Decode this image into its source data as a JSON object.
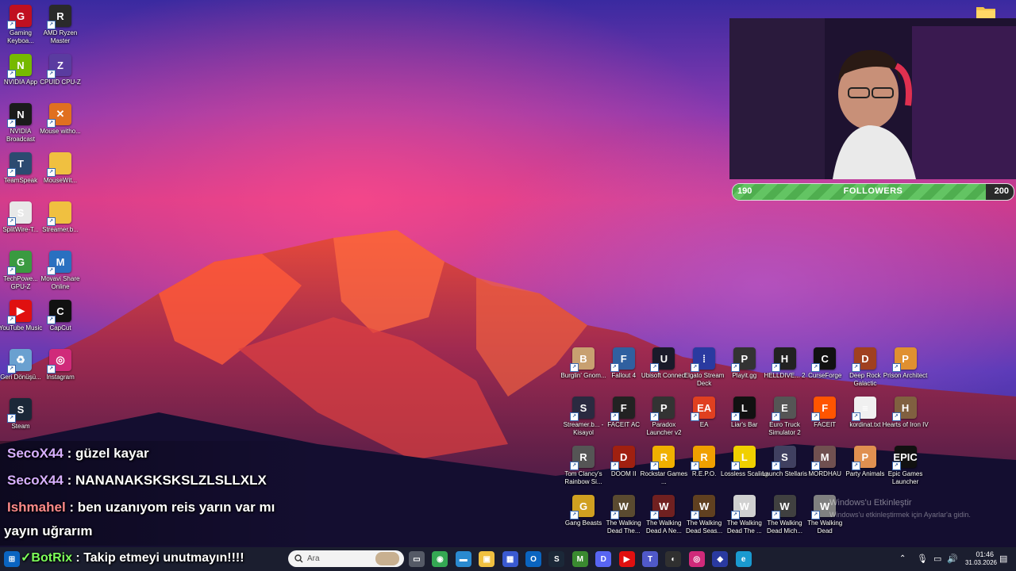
{
  "desktop_left": [
    {
      "name": "gaming-keyboard",
      "label": "Gaming Keyboa...",
      "color": "#c01020",
      "glyph": "G"
    },
    {
      "name": "amd-ryzen-master",
      "label": "AMD Ryzen Master",
      "color": "#2a2a2a",
      "glyph": "R"
    },
    {
      "name": "nvidia-app",
      "label": "NVIDIA App",
      "color": "#76b900",
      "glyph": "N"
    },
    {
      "name": "cpuid-cpu-z",
      "label": "CPUID CPU-Z",
      "color": "#5a3ca0",
      "glyph": "Z"
    },
    {
      "name": "nvidia-broadcast",
      "label": "NVIDIA Broadcast",
      "color": "#1b1b1b",
      "glyph": "N"
    },
    {
      "name": "mouse-without",
      "label": "Mouse witho...",
      "color": "#e07020",
      "glyph": "✕"
    },
    {
      "name": "teamspeak",
      "label": "TeamSpeak",
      "color": "#2c4a70",
      "glyph": "T"
    },
    {
      "name": "mousewit-folder",
      "label": "MouseWit...",
      "color": "#f0c040",
      "glyph": ""
    },
    {
      "name": "splitwire",
      "label": "SplitWire-T...",
      "color": "#e8e8e8",
      "glyph": "S"
    },
    {
      "name": "streamer-folder",
      "label": "Streamer.b...",
      "color": "#f0c040",
      "glyph": ""
    },
    {
      "name": "techpowerup-gpuz",
      "label": "TechPowe... GPU-Z",
      "color": "#3a9a40",
      "glyph": "G"
    },
    {
      "name": "movavi-share",
      "label": "Movavi Share Online",
      "color": "#2a70c0",
      "glyph": "M"
    },
    {
      "name": "youtube-music",
      "label": "YouTube Music",
      "color": "#e01010",
      "glyph": "▶"
    },
    {
      "name": "capcut",
      "label": "CapCut",
      "color": "#111111",
      "glyph": "C"
    },
    {
      "name": "recycle-bin",
      "label": "Geri Dönüşü...",
      "color": "#6aa0d0",
      "glyph": "♻"
    },
    {
      "name": "instagram",
      "label": "Instagram",
      "color": "#d02a7a",
      "glyph": "◎"
    },
    {
      "name": "steam",
      "label": "Steam",
      "color": "#1b2838",
      "glyph": "S"
    }
  ],
  "desktop_right": [
    {
      "name": "burglin-gnomes",
      "label": "Burglin' Gnom...",
      "color": "#c8a070",
      "glyph": "B"
    },
    {
      "name": "fallout-4",
      "label": "Fallout 4",
      "color": "#3060a0",
      "glyph": "F"
    },
    {
      "name": "ubisoft-connect",
      "label": "Ubisoft Connect",
      "color": "#1a1a2a",
      "glyph": "U"
    },
    {
      "name": "elgato-stream-deck",
      "label": "Elgato Stream Deck",
      "color": "#2a3aa0",
      "glyph": "⁞"
    },
    {
      "name": "playit-gg",
      "label": "Playit.gg",
      "color": "#333333",
      "glyph": "P"
    },
    {
      "name": "helldivers-2",
      "label": "HELLDIVE... 2",
      "color": "#222222",
      "glyph": "H"
    },
    {
      "name": "curseforge",
      "label": "CurseForge",
      "color": "#111111",
      "glyph": "C"
    },
    {
      "name": "deep-rock-galactic",
      "label": "Deep Rock Galactic",
      "color": "#a04020",
      "glyph": "D"
    },
    {
      "name": "prison-architect",
      "label": "Prison Architect",
      "color": "#e09030",
      "glyph": "P"
    },
    {
      "name": "streamer-kisayol",
      "label": "Streamer.b... - Kisayol",
      "color": "#2a2a40",
      "glyph": "S"
    },
    {
      "name": "faceit-ac",
      "label": "FACEIT AC",
      "color": "#222222",
      "glyph": "F"
    },
    {
      "name": "paradox-launcher",
      "label": "Paradox Launcher v2",
      "color": "#333333",
      "glyph": "P"
    },
    {
      "name": "ea",
      "label": "EA",
      "color": "#e04020",
      "glyph": "EA"
    },
    {
      "name": "liars-bar",
      "label": "Liar's Bar",
      "color": "#111111",
      "glyph": "L"
    },
    {
      "name": "euro-truck-simulator-2",
      "label": "Euro Truck Simulator 2",
      "color": "#555555",
      "glyph": "E"
    },
    {
      "name": "faceit",
      "label": "FACEIT",
      "color": "#ff5500",
      "glyph": "F"
    },
    {
      "name": "kordinat-txt",
      "label": "kordinat.txt",
      "color": "#f0f0f0",
      "glyph": "≡"
    },
    {
      "name": "hearts-of-iron-iv",
      "label": "Hearts of Iron IV",
      "color": "#806040",
      "glyph": "H"
    },
    {
      "name": "tom-clancys-rainbow",
      "label": "Tom Clancy's Rainbow Si...",
      "color": "#555555",
      "glyph": "R"
    },
    {
      "name": "doom-ii",
      "label": "DOOM II",
      "color": "#a02010",
      "glyph": "D"
    },
    {
      "name": "rockstar-games-launcher",
      "label": "Rockstar Games ...",
      "color": "#f0b000",
      "glyph": "R"
    },
    {
      "name": "repo",
      "label": "R.E.P.O.",
      "color": "#f0a000",
      "glyph": "R"
    },
    {
      "name": "lossless-scaling",
      "label": "Lossless Scaling",
      "color": "#f0d000",
      "glyph": "L"
    },
    {
      "name": "launch-stellaris",
      "label": "Launch Stellaris",
      "color": "#404060",
      "glyph": "S"
    },
    {
      "name": "mordhau",
      "label": "MORDHAU",
      "color": "#705050",
      "glyph": "M"
    },
    {
      "name": "party-animals",
      "label": "Party Animals",
      "color": "#e09050",
      "glyph": "P"
    },
    {
      "name": "epic-games-launcher",
      "label": "Epic Games Launcher",
      "color": "#111111",
      "glyph": "EPIC"
    },
    {
      "name": "gang-beasts",
      "label": "Gang Beasts",
      "color": "#d0a020",
      "glyph": "G"
    },
    {
      "name": "twd-1",
      "label": "The Walking Dead The...",
      "color": "#5a4a30",
      "glyph": "W"
    },
    {
      "name": "twd-2",
      "label": "The Walking Dead A Ne...",
      "color": "#702020",
      "glyph": "W"
    },
    {
      "name": "twd-3",
      "label": "The Walking Dead Seas...",
      "color": "#604020",
      "glyph": "W"
    },
    {
      "name": "twd-4",
      "label": "The Walking Dead The ...",
      "color": "#d0d0d0",
      "glyph": "W"
    },
    {
      "name": "twd-5",
      "label": "The Walking Dead Mich...",
      "color": "#404040",
      "glyph": "W"
    },
    {
      "name": "twd-6",
      "label": "The Walking Dead",
      "color": "#808080",
      "glyph": "W"
    }
  ],
  "followers": {
    "current": "190",
    "goal": "200",
    "label": "FOLLOWERS",
    "progress": 0.9
  },
  "chat": [
    {
      "user": "SecoX44",
      "text": " : güzel kayar",
      "color": "#d8b0ff"
    },
    {
      "user": "SecoX44",
      "text": " : NANANAKSKSKSLZLSLLXLX",
      "color": "#d8b0ff"
    },
    {
      "user": "Ishmahel",
      "text": " : ben uzanıyom reis yarın var mı",
      "color": "#ff8080"
    },
    {
      "user": "",
      "text": "yayın uğrarım",
      "color": "#ffffff"
    },
    {
      "user": "BotRix",
      "text": " : Takip etmeyi unutmayın!!!!",
      "color": "#7dff5a"
    }
  ],
  "taskbar": {
    "search_placeholder": "Ara",
    "clock_time": "01:46",
    "clock_date": "31.03.2026",
    "apps": [
      {
        "name": "task-view-icon",
        "color": "#555a66",
        "glyph": "▭"
      },
      {
        "name": "chrome-icon",
        "color": "#34a853",
        "glyph": "◉"
      },
      {
        "name": "desktop-icon",
        "color": "#2a8ad0",
        "glyph": "▬"
      },
      {
        "name": "file-explorer-icon",
        "color": "#f0c040",
        "glyph": "▣"
      },
      {
        "name": "store-icon",
        "color": "#3a5ad0",
        "glyph": "▦"
      },
      {
        "name": "outlook-icon",
        "color": "#0a64c0",
        "glyph": "O"
      },
      {
        "name": "steam-taskbar-icon",
        "color": "#1b2838",
        "glyph": "S"
      },
      {
        "name": "minecraft-icon",
        "color": "#3a8a30",
        "glyph": "M"
      },
      {
        "name": "discord-icon",
        "color": "#5865f2",
        "glyph": "D"
      },
      {
        "name": "youtube-icon",
        "color": "#e01010",
        "glyph": "▶"
      },
      {
        "name": "teams-icon",
        "color": "#5059c9",
        "glyph": "T"
      },
      {
        "name": "obs-icon",
        "color": "#303030",
        "glyph": "◐"
      },
      {
        "name": "instagram-taskbar-icon",
        "color": "#d02a7a",
        "glyph": "◎"
      },
      {
        "name": "elgato-taskbar-icon",
        "color": "#2a3aa0",
        "glyph": "◆"
      },
      {
        "name": "edge-icon",
        "color": "#1a9ad0",
        "glyph": "e"
      }
    ]
  },
  "watermark": {
    "line1": "Windows'u Etkinleştir",
    "line2": "Windows'u etkinleştirmek için Ayarlar'a gidin."
  }
}
